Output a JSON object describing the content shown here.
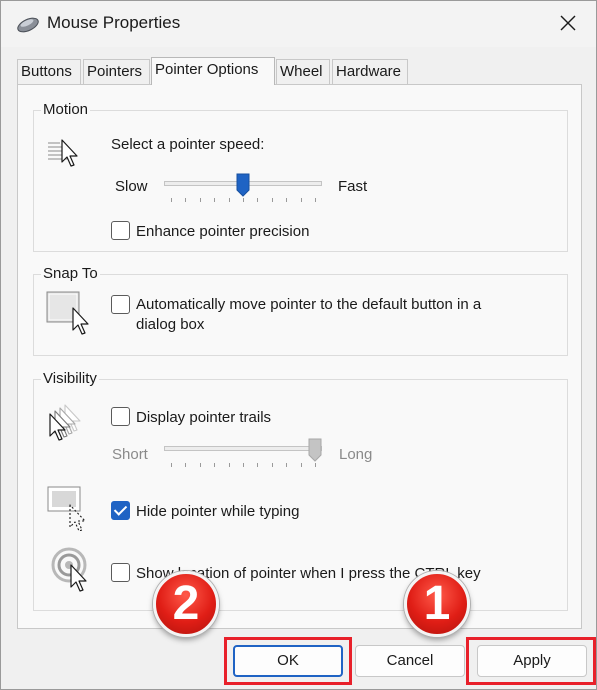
{
  "window": {
    "title": "Mouse Properties",
    "icon": "mouse-icon",
    "close_icon": "close-icon"
  },
  "tabs": [
    {
      "label": "Buttons",
      "active": false
    },
    {
      "label": "Pointers",
      "active": false
    },
    {
      "label": "Pointer Options",
      "active": true
    },
    {
      "label": "Wheel",
      "active": false
    },
    {
      "label": "Hardware",
      "active": false
    }
  ],
  "motion": {
    "title": "Motion",
    "icon": "pointer-speed-icon",
    "speed_label": "Select a pointer speed:",
    "slow_label": "Slow",
    "fast_label": "Fast",
    "speed_level": 0.5,
    "enhance_precision": {
      "label": "Enhance pointer precision",
      "checked": false
    }
  },
  "snap_to": {
    "title": "Snap To",
    "icon": "snap-to-button-icon",
    "auto_move": {
      "label_line1": "Automatically move pointer to the default button in a",
      "label_line2": "dialog box",
      "checked": false
    }
  },
  "visibility": {
    "title": "Visibility",
    "trails_icon": "pointer-trails-icon",
    "trails": {
      "label": "Display pointer trails",
      "checked": false
    },
    "short_label": "Short",
    "long_label": "Long",
    "trail_level": 1.0,
    "hide_icon": "hide-pointer-icon",
    "hide_while_typing": {
      "label": "Hide pointer while typing",
      "checked": true
    },
    "ctrl_icon": "pointer-location-icon",
    "show_location": {
      "label": "Show location of pointer when I press the CTRL key",
      "checked": false
    }
  },
  "buttons": {
    "ok": "OK",
    "cancel": "Cancel",
    "apply": "Apply"
  },
  "annotations": {
    "badge_ok": "2",
    "badge_apply": "1",
    "highlight_color": "#e8202a",
    "badge_color": "#e01e16"
  },
  "colors": {
    "accent": "#1f63c4"
  }
}
